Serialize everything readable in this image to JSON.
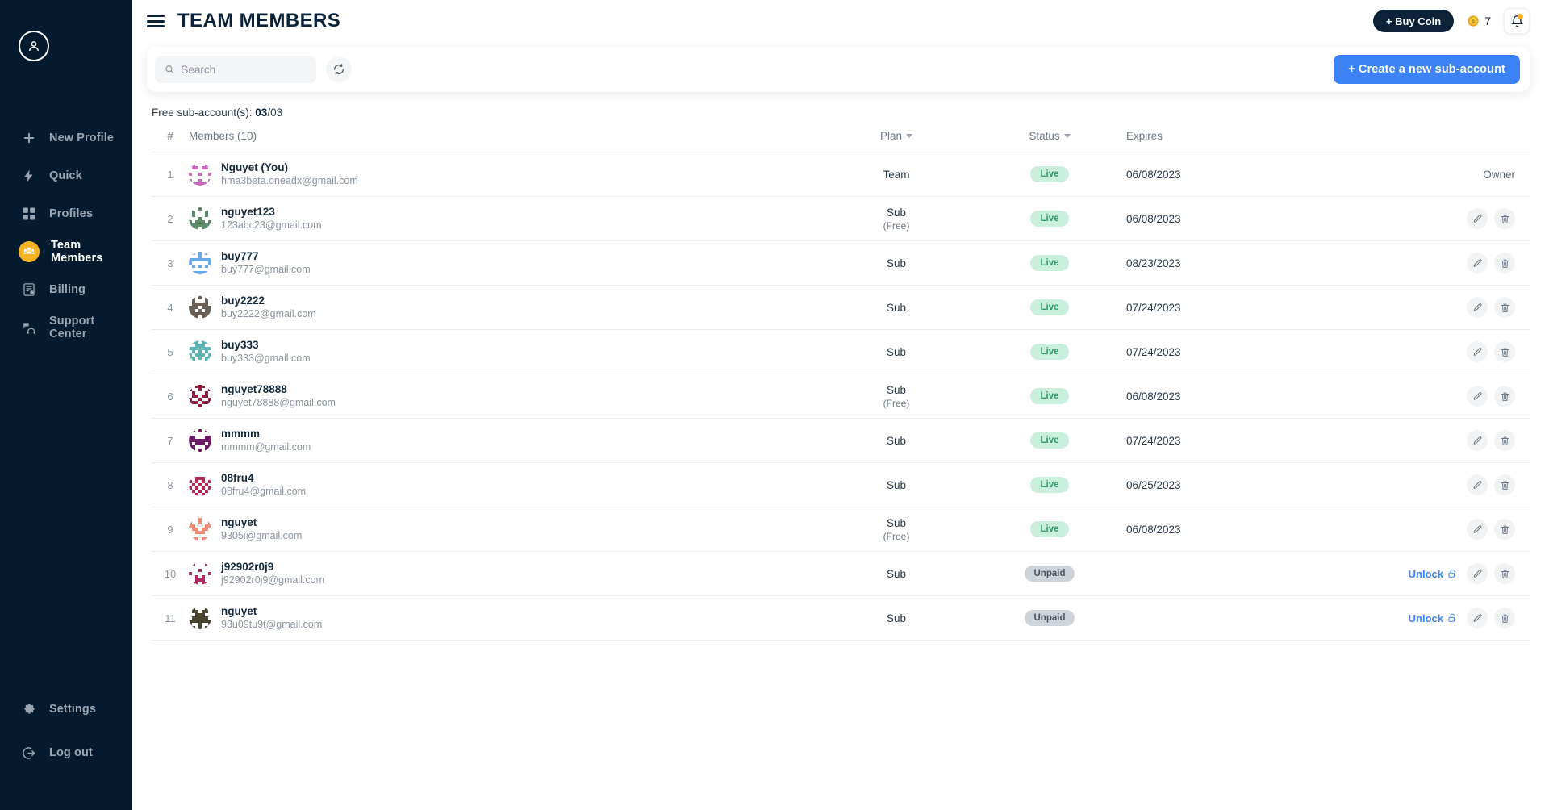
{
  "sidebar": {
    "avatar_icon": "user-circle-icon",
    "items": [
      {
        "label": "New Profile",
        "icon": "plus-icon",
        "active": false
      },
      {
        "label": "Quick",
        "icon": "bolt-icon",
        "active": false
      },
      {
        "label": "Profiles",
        "icon": "grid-icon",
        "active": false
      },
      {
        "label": "Team Members",
        "icon": "users-icon",
        "active": true
      },
      {
        "label": "Billing",
        "icon": "invoice-icon",
        "active": false
      },
      {
        "label": "Support Center",
        "icon": "headset-icon",
        "active": false
      }
    ],
    "bottom_items": [
      {
        "label": "Settings",
        "icon": "gear-icon"
      },
      {
        "label": "Log out",
        "icon": "logout-icon"
      }
    ],
    "active_color": "#f5b324",
    "background": "#031a2f"
  },
  "header": {
    "menu_icon": "hamburger-icon",
    "title": "TEAM MEMBERS",
    "buy_coin_label": "+ Buy Coin",
    "coin_icon": "coin-icon",
    "coin_count": "7",
    "bell_icon": "bell-icon",
    "has_notification": true
  },
  "toolbar": {
    "search_placeholder": "Search",
    "search_value": "",
    "search_icon": "search-icon",
    "refresh_icon": "refresh-icon",
    "create_label": "+ Create a new sub-account",
    "create_color": "#3b82f6"
  },
  "summary": {
    "free_label": "Free sub-account(s): ",
    "free_used": "03",
    "free_total": "/03"
  },
  "table": {
    "columns": {
      "index": "#",
      "members": "Members (10)",
      "plan": "Plan",
      "status": "Status",
      "expires": "Expires",
      "actions": ""
    },
    "sortable": [
      "plan",
      "status"
    ],
    "rows": [
      {
        "index": "1",
        "name": "Nguyet (You)",
        "email": "hma3beta.oneadx@gmail.com",
        "plan": "Team",
        "plan_note": "",
        "status": "Live",
        "expires": "06/08/2023",
        "owner": "Owner",
        "unlock": "",
        "avatar_color": "#cc6bbf"
      },
      {
        "index": "2",
        "name": "nguyet123",
        "email": "123abc23@gmail.com",
        "plan": "Sub",
        "plan_note": "(Free)",
        "status": "Live",
        "expires": "06/08/2023",
        "owner": "",
        "unlock": "",
        "avatar_color": "#5c8a6a"
      },
      {
        "index": "3",
        "name": "buy777",
        "email": "buy777@gmail.com",
        "plan": "Sub",
        "plan_note": "",
        "status": "Live",
        "expires": "08/23/2023",
        "owner": "",
        "unlock": "",
        "avatar_color": "#6aa8e8"
      },
      {
        "index": "4",
        "name": "buy2222",
        "email": "buy2222@gmail.com",
        "plan": "Sub",
        "plan_note": "",
        "status": "Live",
        "expires": "07/24/2023",
        "owner": "",
        "unlock": "",
        "avatar_color": "#6b5f55"
      },
      {
        "index": "5",
        "name": "buy333",
        "email": "buy333@gmail.com",
        "plan": "Sub",
        "plan_note": "",
        "status": "Live",
        "expires": "07/24/2023",
        "owner": "",
        "unlock": "",
        "avatar_color": "#5eb3b3"
      },
      {
        "index": "6",
        "name": "nguyet78888",
        "email": "nguyet78888@gmail.com",
        "plan": "Sub",
        "plan_note": "(Free)",
        "status": "Live",
        "expires": "06/08/2023",
        "owner": "",
        "unlock": "",
        "avatar_color": "#8e1f3a"
      },
      {
        "index": "7",
        "name": "mmmm",
        "email": "mmmm@gmail.com",
        "plan": "Sub",
        "plan_note": "",
        "status": "Live",
        "expires": "07/24/2023",
        "owner": "",
        "unlock": "",
        "avatar_color": "#6d1b64"
      },
      {
        "index": "8",
        "name": "08fru4",
        "email": "08fru4@gmail.com",
        "plan": "Sub",
        "plan_note": "",
        "status": "Live",
        "expires": "06/25/2023",
        "owner": "",
        "unlock": "",
        "avatar_color": "#b52a55"
      },
      {
        "index": "9",
        "name": "nguyet",
        "email": "9305i@gmail.com",
        "plan": "Sub",
        "plan_note": "(Free)",
        "status": "Live",
        "expires": "06/08/2023",
        "owner": "",
        "unlock": "",
        "avatar_color": "#f08a72"
      },
      {
        "index": "10",
        "name": "j92902r0j9",
        "email": "j92902r0j9@gmail.com",
        "plan": "Sub",
        "plan_note": "",
        "status": "Unpaid",
        "expires": "",
        "owner": "",
        "unlock": "Unlock",
        "avatar_color": "#a92b62"
      },
      {
        "index": "11",
        "name": "nguyet",
        "email": "93u09tu9t@gmail.com",
        "plan": "Sub",
        "plan_note": "",
        "status": "Unpaid",
        "expires": "",
        "owner": "",
        "unlock": "Unlock",
        "avatar_color": "#4a4430"
      }
    ],
    "row_action_icons": [
      "edit-pencil-icon",
      "trash-icon"
    ],
    "unlock_icon": "unlock-icon",
    "status_colors": {
      "live_bg": "#caf0dd",
      "live_fg": "#2f9a68",
      "unpaid_bg": "#ced4da",
      "unpaid_fg": "#4a5560"
    }
  }
}
